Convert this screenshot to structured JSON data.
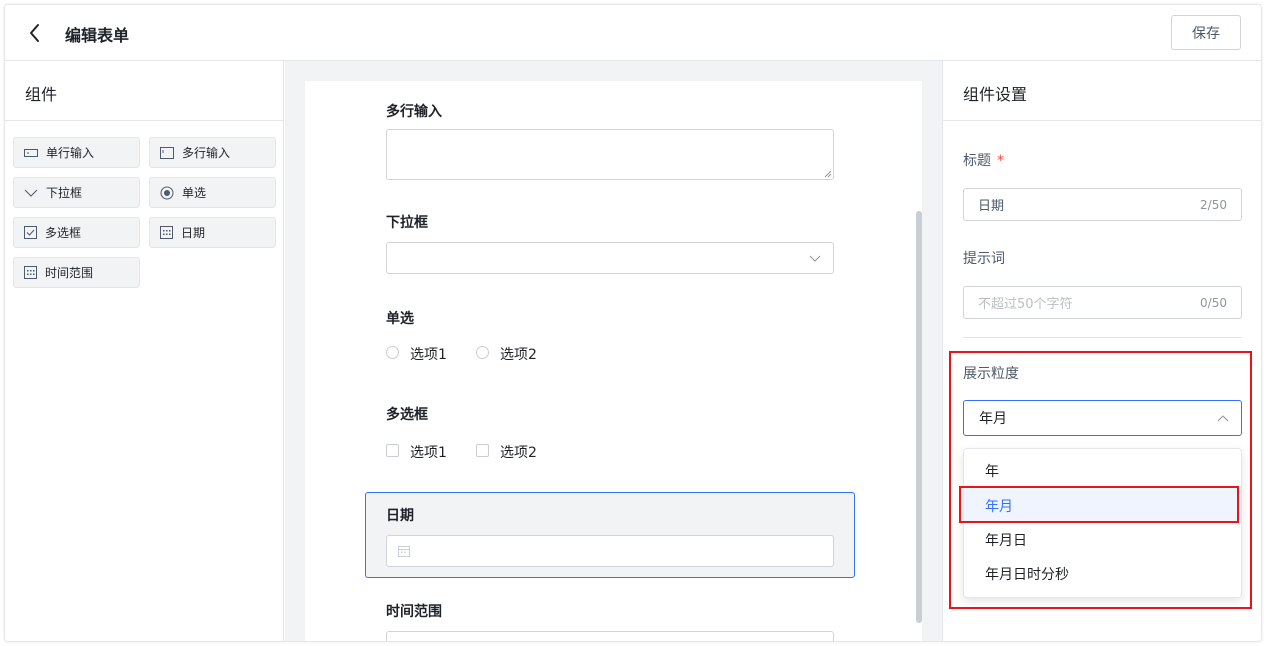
{
  "header": {
    "title": "编辑表单",
    "save_label": "保存"
  },
  "components_panel": {
    "title": "组件",
    "items": [
      {
        "label": "单行输入",
        "icon": "single-line-input-icon"
      },
      {
        "label": "多行输入",
        "icon": "multi-line-input-icon"
      },
      {
        "label": "下拉框",
        "icon": "chevron-down-icon"
      },
      {
        "label": "单选",
        "icon": "radio-icon"
      },
      {
        "label": "多选框",
        "icon": "checkbox-icon"
      },
      {
        "label": "日期",
        "icon": "calendar-icon"
      },
      {
        "label": "时间范围",
        "icon": "calendar-icon"
      }
    ]
  },
  "form": {
    "multiline": {
      "label": "多行输入"
    },
    "dropdown": {
      "label": "下拉框"
    },
    "radio": {
      "label": "单选",
      "options": [
        "选项1",
        "选项2"
      ]
    },
    "checkbox": {
      "label": "多选框",
      "options": [
        "选项1",
        "选项2"
      ]
    },
    "date": {
      "label": "日期"
    },
    "time_range": {
      "label": "时间范围"
    }
  },
  "settings": {
    "title": "组件设置",
    "title_field": {
      "label": "标题",
      "required_mark": "*",
      "value": "日期",
      "count": "2/50"
    },
    "hint_field": {
      "label": "提示词",
      "placeholder": "不超过50个字符",
      "count": "0/50"
    },
    "granularity": {
      "label": "展示粒度",
      "selected": "年月",
      "options": [
        "年",
        "年月",
        "年月日",
        "年月日时分秒"
      ]
    }
  },
  "colors": {
    "accent": "#3370ff",
    "highlight_box": "#e8131b",
    "required": "#f54a45"
  }
}
